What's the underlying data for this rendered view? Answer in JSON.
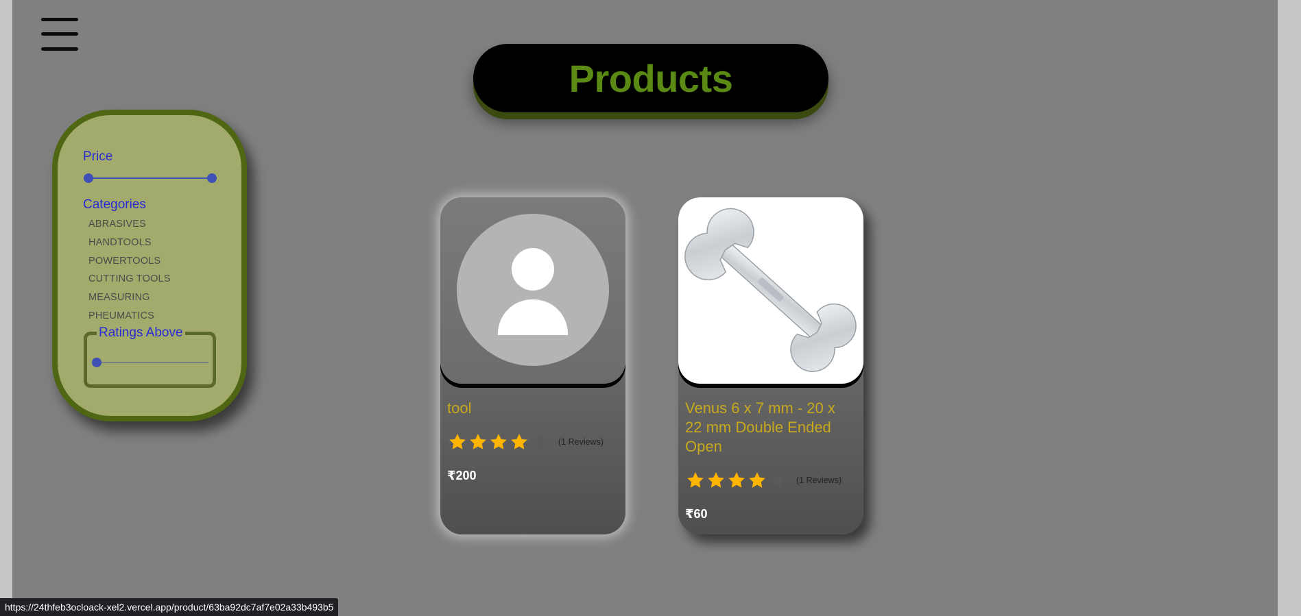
{
  "header": {
    "title": "Products"
  },
  "filters": {
    "price_heading": "Price",
    "categories_heading": "Categories",
    "categories": [
      "ABRASIVES",
      "HANDTOOLS",
      "POWERTOOLS",
      "CUTTING TOOLS",
      "MEASURING",
      "PHEUMATICS"
    ],
    "ratings_legend": "Ratings Above",
    "price_range_fraction": [
      0,
      1
    ],
    "ratings_above_fraction": 0
  },
  "products": [
    {
      "name": "tool",
      "rating": 4,
      "rating_max": 5,
      "reviews": "(1 Reviews)",
      "price": "₹200",
      "image": "user-avatar-placeholder"
    },
    {
      "name": "Venus 6 x 7 mm - 20 x 22 mm Double Ended Open",
      "rating": 4,
      "rating_max": 5,
      "reviews": "(1 Reviews)",
      "price": "₹60",
      "image": "wrench-photo"
    }
  ],
  "colors": {
    "title_text": "#5a8a14",
    "filter_bg": "#a3ab6c",
    "filter_border": "#4f6612",
    "accent_blue": "#3f51b5",
    "product_name": "#c7a91c",
    "star_filled": "#ffb400",
    "star_empty": "#5a5a5a"
  },
  "status_bar": {
    "url": "https://24thfeb3ocloack-xel2.vercel.app/product/63ba92dc7af7e02a33b493b5"
  }
}
